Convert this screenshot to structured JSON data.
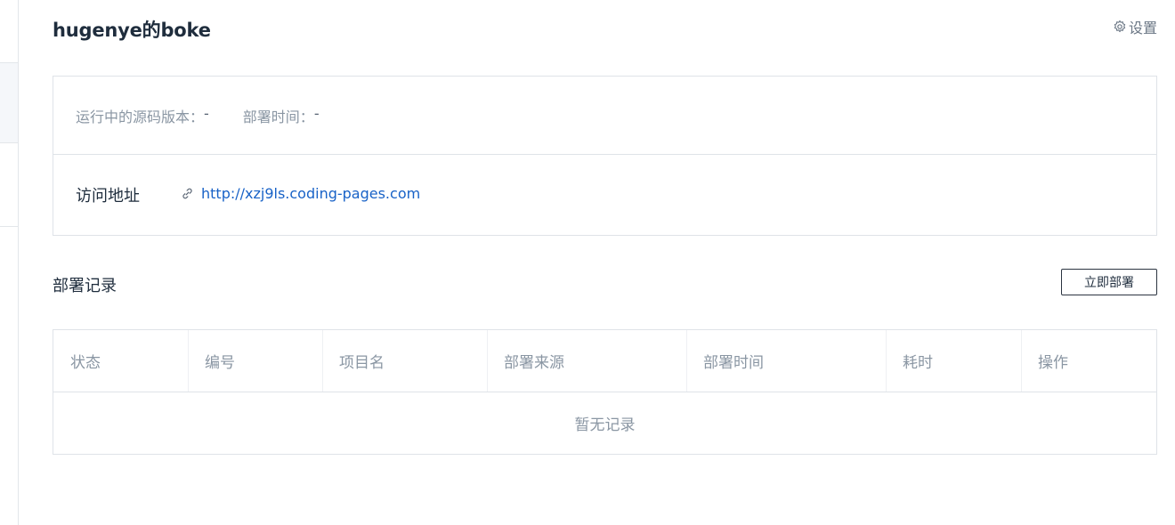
{
  "header": {
    "title": "hugenye的boke",
    "settings_label": "设置",
    "settings_icon": "gear-icon"
  },
  "info": {
    "source_version_label": "运行中的源码版本：",
    "source_version_value": "-",
    "deploy_time_label": "部署时间：",
    "deploy_time_value": "-",
    "visit_label": "访问地址",
    "visit_url": "http://xzj9ls.coding-pages.com",
    "link_icon": "link-icon"
  },
  "records": {
    "title": "部署记录",
    "deploy_button_label": "立即部署",
    "columns": [
      "状态",
      "编号",
      "项目名",
      "部署来源",
      "部署时间",
      "耗时",
      "操作"
    ],
    "empty_text": "暂无记录"
  },
  "colors": {
    "link": "#1862c7",
    "muted_text": "#8a96a3",
    "border": "#dfe3e8",
    "primary_text": "#1f2d3d"
  }
}
